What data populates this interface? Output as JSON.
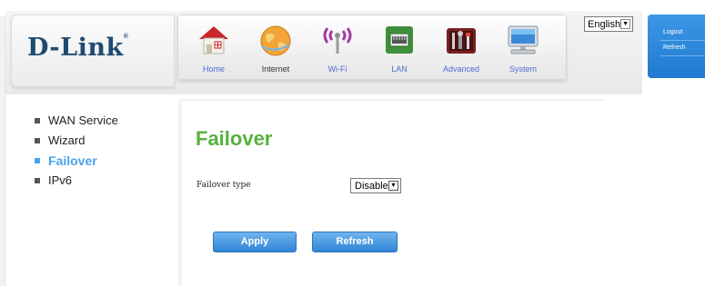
{
  "brand": {
    "name": "D-Link",
    "mark": "®"
  },
  "nav": {
    "items": [
      {
        "label": "Home",
        "icon": "home-icon"
      },
      {
        "label": "Internet",
        "icon": "globe-icon"
      },
      {
        "label": "Wi-Fi",
        "icon": "wifi-icon"
      },
      {
        "label": "LAN",
        "icon": "lan-icon"
      },
      {
        "label": "Advanced",
        "icon": "tools-icon"
      },
      {
        "label": "System",
        "icon": "computer-icon"
      }
    ]
  },
  "language": {
    "selected": "English"
  },
  "side_links": {
    "logout": "Logout",
    "refresh": "Refresh"
  },
  "menu": {
    "items": [
      {
        "label": "WAN Service"
      },
      {
        "label": "Wizard"
      },
      {
        "label": "Failover"
      },
      {
        "label": "IPv6"
      }
    ]
  },
  "page": {
    "title": "Failover",
    "failover_type_label": "Failover type",
    "failover_type_value": "Disable"
  },
  "buttons": {
    "apply": "Apply",
    "refresh": "Refresh"
  },
  "colors": {
    "accent_blue": "#3d97e6",
    "title_green": "#58b13f",
    "brand_navy": "#1e4a72"
  }
}
